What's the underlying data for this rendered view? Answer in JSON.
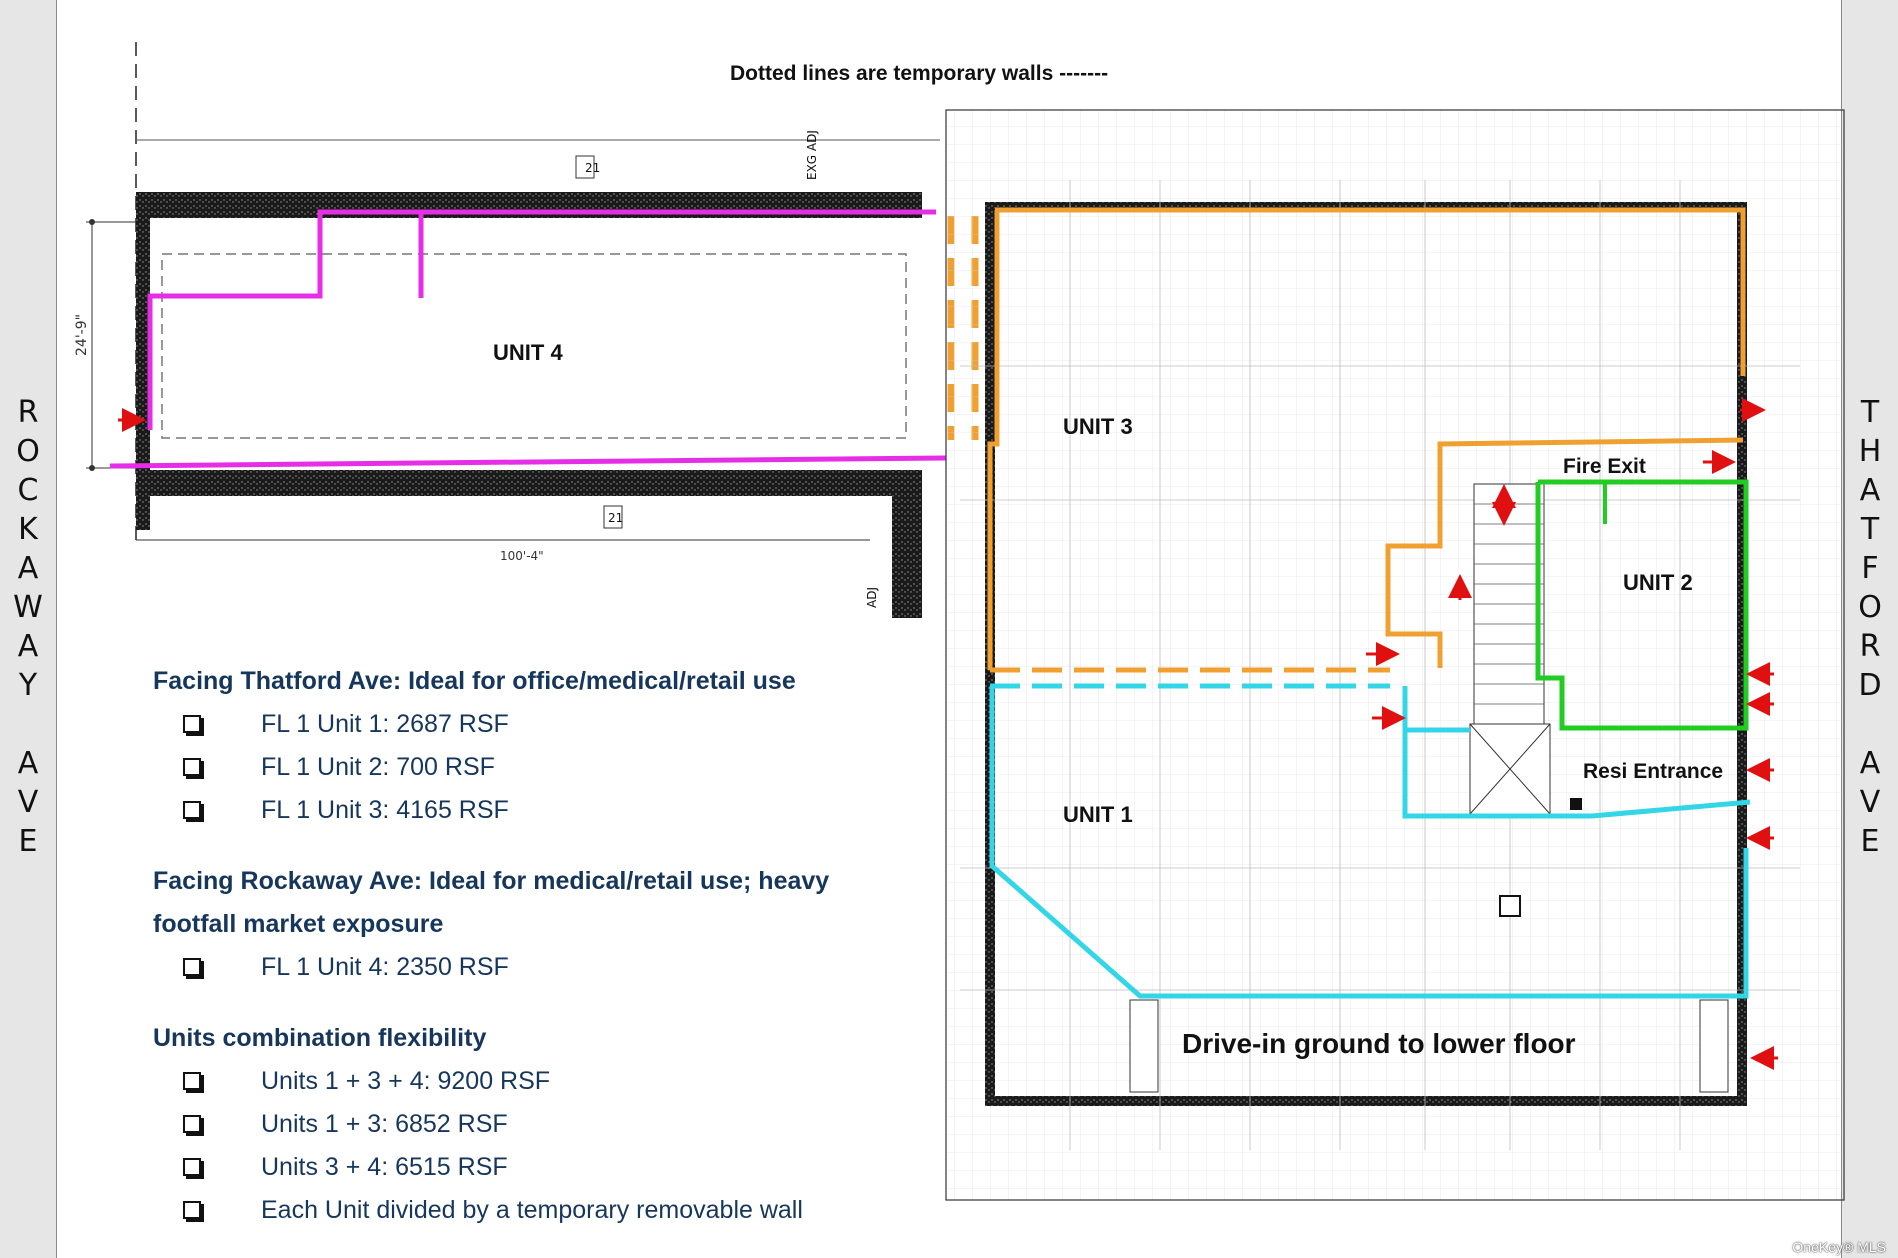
{
  "top_note": "Dotted lines are temporary walls -------",
  "streets": {
    "left": [
      "R",
      "O",
      "C",
      "K",
      "A",
      "W",
      "A",
      "Y",
      "",
      "A",
      "V",
      "E"
    ],
    "right": [
      "T",
      "H",
      "A",
      "T",
      "F",
      "O",
      "R",
      "D",
      "",
      "A",
      "V",
      "E"
    ]
  },
  "plan": {
    "unit4": "UNIT 4",
    "unit3": "UNIT 3",
    "unit2": "UNIT 2",
    "unit1": "UNIT 1",
    "fire_exit": "Fire Exit",
    "resi_entrance": "Resi Entrance",
    "drive_in": "Drive-in ground to lower floor",
    "dim_width": "100'-4\"",
    "dim_height": "24'-9\"",
    "tag_21": "21",
    "exg_adj": "EXG ADJ",
    "adj": "ADJ"
  },
  "colors": {
    "unit4_outline": "#e62ee6",
    "unit3_outline": "#f0a030",
    "unit2_outline": "#22cc22",
    "unit1_outline": "#33d6e6",
    "arrow": "#e01010",
    "heading_text": "#16365c"
  },
  "sections": [
    {
      "heading": "Facing Thatford Ave: Ideal for office/medical/retail use",
      "items": [
        "FL 1 Unit 1:  2687 RSF",
        "FL 1 Unit 2: 700 RSF",
        "FL 1 Unit 3: 4165 RSF"
      ]
    },
    {
      "heading": "Facing Rockaway Ave: Ideal for medical/retail use; heavy footfall market exposure",
      "items": [
        "FL 1 Unit 4: 2350 RSF"
      ]
    },
    {
      "heading": "Units combination flexibility",
      "items": [
        "Units 1 + 3 + 4: 9200 RSF",
        "Units 1 + 3: 6852 RSF",
        "Units 3 + 4: 6515 RSF",
        "Each Unit divided by a temporary removable wall"
      ]
    }
  ],
  "footer_brand": "OneKey® MLS"
}
